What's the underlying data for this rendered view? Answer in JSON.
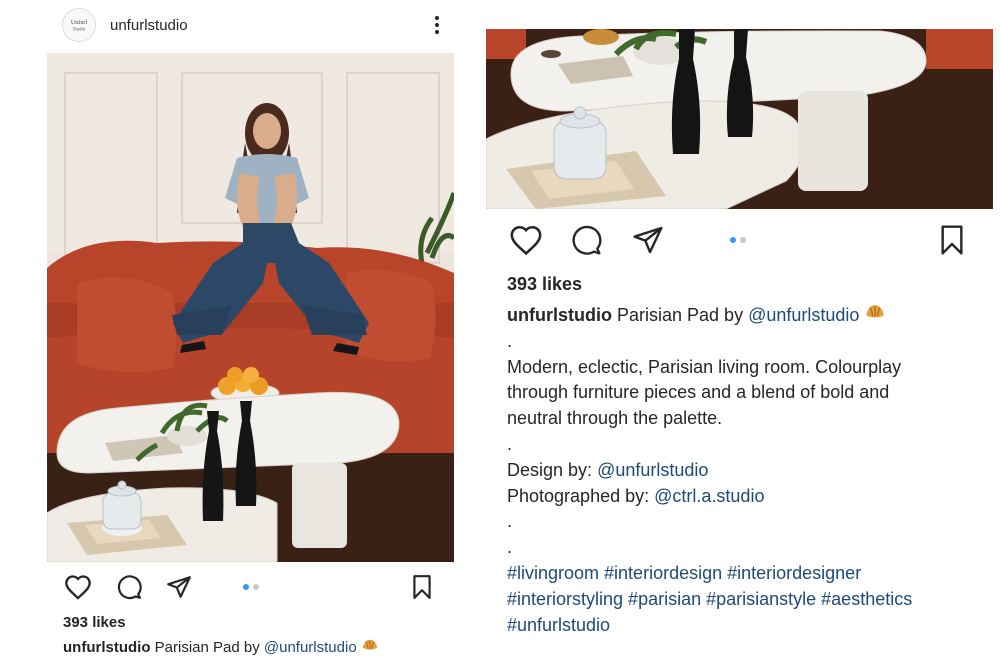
{
  "post": {
    "username": "unfurlstudio",
    "avatar_text": [
      "Unfurl",
      "Studio"
    ],
    "likes": "393 likes",
    "caption_title": "Parisian Pad by",
    "caption_mention": "@unfurlstudio",
    "body_lines": [
      ".",
      "Modern, eclectic, Parisian living room. Colourplay",
      "through furniture pieces and a blend of bold and",
      "neutral through the palette.",
      "."
    ],
    "design_label": "Design by:",
    "design_mention": "@unfurlstudio",
    "photo_label": "Photographed by:",
    "photo_mention": "@ctrl.a.studio",
    "dot_lines": [
      ".",
      "."
    ],
    "hashtag_lines": [
      "#livingroom #interiordesign #interiordesigner",
      "#interiorstyling #parisian #parisianstyle #aesthetics",
      "#unfurlstudio"
    ],
    "carousel": {
      "count": 2,
      "active": 1
    }
  },
  "icons": {
    "more": "more-options-icon",
    "like": "heart-icon",
    "comment": "comment-bubble-icon",
    "share": "paper-plane-icon",
    "save": "bookmark-icon",
    "emoji": "croissant-emoji"
  },
  "colors": {
    "text": "#262626",
    "link": "#1e4a7a",
    "dot_active": "#3897f0",
    "dot_inactive": "#c8c8c8",
    "sofa": "#b8452a"
  }
}
